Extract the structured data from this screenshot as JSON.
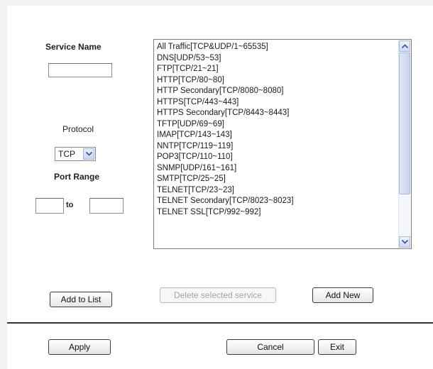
{
  "form": {
    "service_name_label": "Service Name",
    "service_name_value": "",
    "protocol_label": "Protocol",
    "protocol_selected": "TCP",
    "port_range_label": "Port Range",
    "port_from_value": "",
    "port_to_label": "to",
    "port_to_value": ""
  },
  "services_list": {
    "items": [
      "All Traffic[TCP&UDP/1~65535]",
      "DNS[UDP/53~53]",
      "FTP[TCP/21~21]",
      "HTTP[TCP/80~80]",
      "HTTP Secondary[TCP/8080~8080]",
      "HTTPS[TCP/443~443]",
      "HTTPS Secondary[TCP/8443~8443]",
      "TFTP[UDP/69~69]",
      "IMAP[TCP/143~143]",
      "NNTP[TCP/119~119]",
      "POP3[TCP/110~110]",
      "SNMP[UDP/161~161]",
      "SMTP[TCP/25~25]",
      "TELNET[TCP/23~23]",
      "TELNET Secondary[TCP/8023~8023]",
      "TELNET SSL[TCP/992~992]"
    ]
  },
  "buttons": {
    "add_to_list": "Add to List",
    "delete_selected": "Delete selected service",
    "add_new": "Add New",
    "apply": "Apply",
    "cancel": "Cancel",
    "exit": "Exit"
  },
  "icons": {
    "dropdown": "chevron-down-icon",
    "scroll_up": "chevron-up-icon",
    "scroll_down": "chevron-down-icon"
  }
}
